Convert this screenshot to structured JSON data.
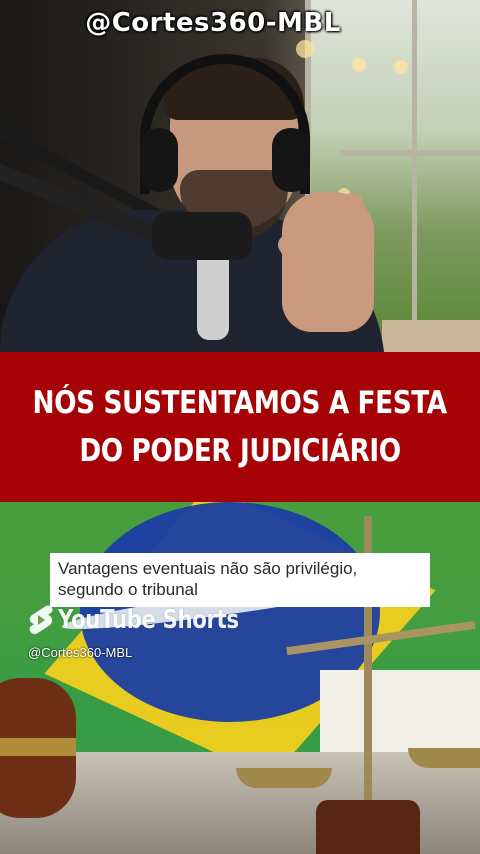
{
  "watermark_top": "@Cortes360-MBL",
  "headline": {
    "line1": "NÓS SUSTENTAMOS A FESTA",
    "line2": "DO PODER JUDICIÁRIO"
  },
  "caption": {
    "line1": "Vantagens eventuais não são privilégio,",
    "line2": "segundo o tribunal"
  },
  "youtube_shorts": {
    "label": "YouTube Shorts",
    "handle": "@Cortes360-MBL"
  },
  "icons": [
    "youtube-shorts-icon"
  ],
  "colors": {
    "headline_band": "#a50306",
    "headline_text": "#ffffff",
    "caption_bg": "#ffffff",
    "caption_text": "#2a2a2a"
  }
}
